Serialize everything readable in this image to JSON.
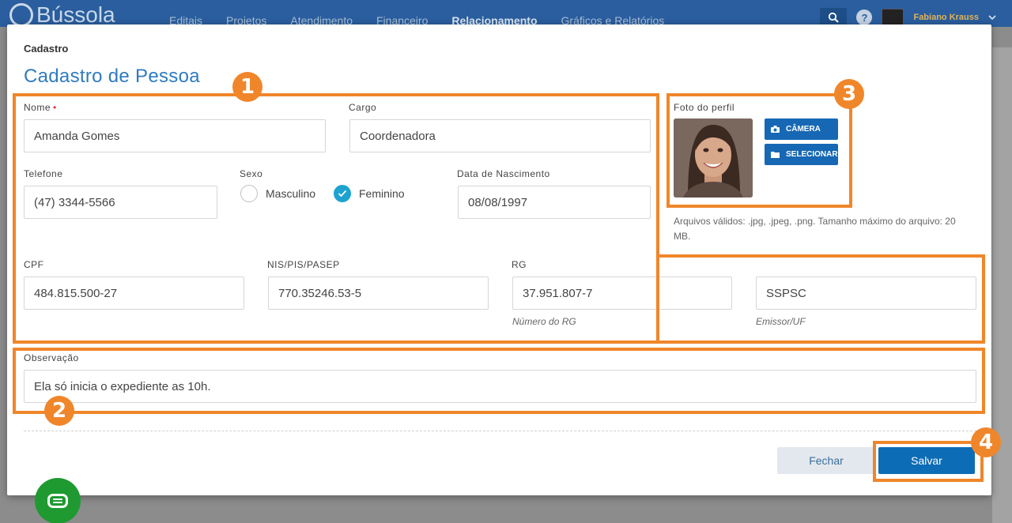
{
  "app": {
    "brand": "Bússola",
    "nav": [
      "Editais",
      "Projetos",
      "Atendimento",
      "Financeiro",
      "Relacionamento",
      "Gráficos e Relatórios"
    ],
    "active_nav": "Relacionamento",
    "user_name": "Fabiano Krauss"
  },
  "modal": {
    "kicker": "Cadastro",
    "title": "Cadastro de Pessoa"
  },
  "form": {
    "nome": {
      "label": "Nome",
      "value": "Amanda Gomes"
    },
    "cargo": {
      "label": "Cargo",
      "value": "Coordenadora"
    },
    "telefone": {
      "label": "Telefone",
      "value": "(47) 3344-5566"
    },
    "sexo": {
      "label": "Sexo",
      "options": [
        "Masculino",
        "Feminino"
      ],
      "selected": "Feminino"
    },
    "nascimento": {
      "label": "Data de Nascimento",
      "value": "08/08/1997"
    },
    "cpf": {
      "label": "CPF",
      "value": "484.815.500-27"
    },
    "nis": {
      "label": "NIS/PIS/PASEP",
      "value": "770.35246.53-5"
    },
    "rg": {
      "label": "RG",
      "value": "37.951.807-7",
      "hint": "Número do RG"
    },
    "emissor": {
      "value": "SSPSC",
      "hint": "Emissor/UF"
    },
    "observacao": {
      "label": "Observação",
      "value": "Ela só inicia o expediente as 10h."
    }
  },
  "photo": {
    "label": "Foto do perfil",
    "camera_button": "CÂMERA",
    "select_button": "SELECIONAR",
    "file_note": "Arquivos válidos: .jpg, .jpeg, .png. Tamanho máximo do arquivo: 20 MB."
  },
  "actions": {
    "close_label": "Fechar",
    "save_label": "Salvar"
  },
  "callouts": [
    "1",
    "2",
    "3",
    "4"
  ],
  "colors": {
    "accent": "#f0862a",
    "primary": "#0d6cb6",
    "title": "#2f7bbf",
    "radio_on": "#1ea3d0"
  }
}
